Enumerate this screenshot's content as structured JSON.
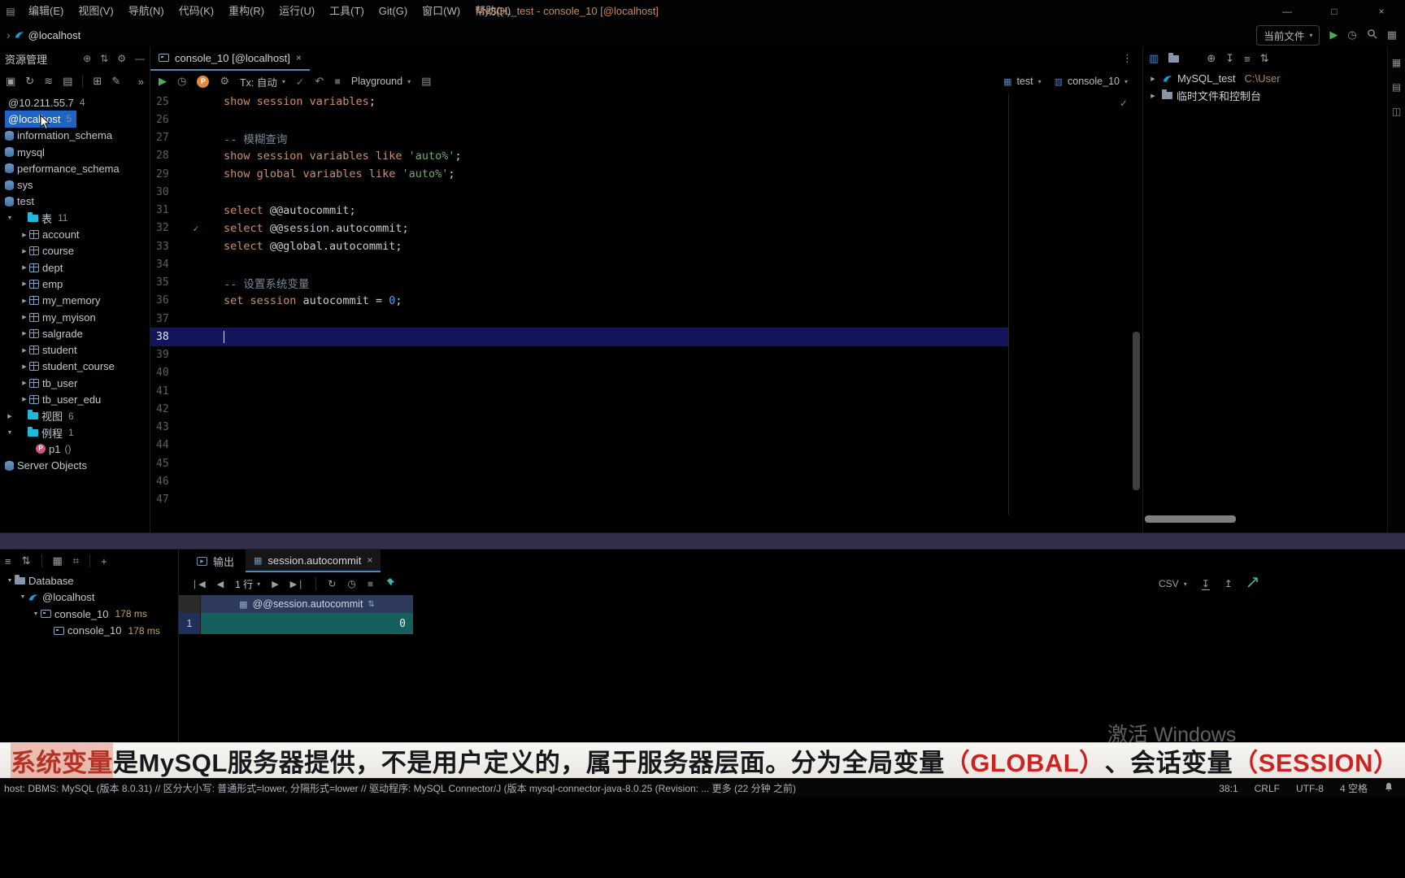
{
  "colors": {
    "accent_blue": "#1f63c4",
    "keyword_orange": "#cf8e6d",
    "string_green": "#6aab73",
    "number_blue": "#4fa0e8",
    "folder_cyan": "#1fb9da",
    "result_row_teal": "#15605c",
    "banner_red": "#cc2222"
  },
  "titlebar": {
    "menus": [
      "编辑(E)",
      "视图(V)",
      "导航(N)",
      "代码(K)",
      "重构(R)",
      "运行(U)",
      "工具(T)",
      "Git(G)",
      "窗口(W)",
      "帮助(H)"
    ],
    "title": "MySQL_test - console_10 [@localhost]",
    "window_controls": [
      "—",
      "□",
      "×"
    ]
  },
  "navbar": {
    "breadcrumb": "@localhost",
    "run_config": "当前文件"
  },
  "explorer": {
    "header": "资源管理",
    "tree": [
      {
        "label": "@10.211.55.7",
        "count": "4",
        "type": "host"
      },
      {
        "label": "@localhost",
        "count": "5",
        "type": "host",
        "sel": true
      },
      {
        "label": "information_schema",
        "type": "schema"
      },
      {
        "label": "mysql",
        "type": "schema"
      },
      {
        "label": "performance_schema",
        "type": "schema"
      },
      {
        "label": "sys",
        "type": "schema"
      },
      {
        "label": "test",
        "type": "schema"
      },
      {
        "label": "表",
        "count": "11",
        "type": "folder",
        "exp": true
      },
      {
        "label": "account",
        "type": "table"
      },
      {
        "label": "course",
        "type": "table"
      },
      {
        "label": "dept",
        "type": "table"
      },
      {
        "label": "emp",
        "type": "table"
      },
      {
        "label": "my_memory",
        "type": "table"
      },
      {
        "label": "my_myison",
        "type": "table"
      },
      {
        "label": "salgrade",
        "type": "table"
      },
      {
        "label": "student",
        "type": "table"
      },
      {
        "label": "student_course",
        "type": "table"
      },
      {
        "label": "tb_user",
        "type": "table"
      },
      {
        "label": "tb_user_edu",
        "type": "table"
      },
      {
        "label": "视图",
        "count": "6",
        "type": "folder",
        "exp": false
      },
      {
        "label": "例程",
        "count": "1",
        "type": "folder",
        "exp": true
      },
      {
        "label": "p1",
        "suffix": "()",
        "type": "proc"
      },
      {
        "label": "Server Objects",
        "type": "server"
      }
    ]
  },
  "editor": {
    "tab": "console_10 [@localhost]",
    "toolbar": {
      "tx_label": "Tx: 自动",
      "playground_label": "Playground",
      "db_selector": "test",
      "console_selector": "console_10"
    },
    "lines": [
      {
        "n": 25,
        "seg": [
          [
            "kw",
            "show session variables"
          ],
          [
            "pl",
            ";"
          ]
        ]
      },
      {
        "n": 26,
        "seg": []
      },
      {
        "n": 27,
        "seg": [
          [
            "cm",
            "-- 模糊查询"
          ]
        ]
      },
      {
        "n": 28,
        "seg": [
          [
            "kw",
            "show session variables like "
          ],
          [
            "str",
            "'auto%'"
          ],
          [
            "pl",
            ";"
          ]
        ]
      },
      {
        "n": 29,
        "seg": [
          [
            "kw",
            "show global variables like "
          ],
          [
            "str",
            "'auto%'"
          ],
          [
            "pl",
            ";"
          ]
        ]
      },
      {
        "n": 30,
        "seg": []
      },
      {
        "n": 31,
        "seg": [
          [
            "kw",
            "select "
          ],
          [
            "pl",
            "@@autocommit;"
          ]
        ]
      },
      {
        "n": 32,
        "mark": true,
        "seg": [
          [
            "kw",
            "select "
          ],
          [
            "pl",
            "@@session.autocommit;"
          ]
        ]
      },
      {
        "n": 33,
        "seg": [
          [
            "kw",
            "select "
          ],
          [
            "pl",
            "@@global.autocommit;"
          ]
        ]
      },
      {
        "n": 34,
        "seg": []
      },
      {
        "n": 35,
        "seg": [
          [
            "cm",
            "-- 设置系统变量"
          ]
        ]
      },
      {
        "n": 36,
        "seg": [
          [
            "kw",
            "set session "
          ],
          [
            "pl",
            "autocommit = "
          ],
          [
            "num",
            "0"
          ],
          [
            "pl",
            ";"
          ]
        ]
      },
      {
        "n": 37,
        "seg": []
      },
      {
        "n": 38,
        "cur": true,
        "seg": []
      },
      {
        "n": 39,
        "seg": []
      },
      {
        "n": 40,
        "seg": []
      },
      {
        "n": 41,
        "seg": []
      },
      {
        "n": 42,
        "seg": []
      },
      {
        "n": 43,
        "seg": []
      },
      {
        "n": 44,
        "seg": []
      },
      {
        "n": 45,
        "seg": []
      },
      {
        "n": 46,
        "seg": []
      },
      {
        "n": 47,
        "seg": []
      }
    ]
  },
  "right_panel": {
    "root": "MySQL_test",
    "root_path": "C:\\User",
    "child": "临时文件和控制台"
  },
  "services": {
    "tree": [
      {
        "label": "Database",
        "type": "dbfolder",
        "lvl": 0,
        "exp": true
      },
      {
        "label": "@localhost",
        "type": "mysql",
        "lvl": 1,
        "exp": true
      },
      {
        "label": "console_10",
        "time": "178 ms",
        "type": "console",
        "lvl": 2,
        "exp": true
      },
      {
        "label": "console_10",
        "time": "178 ms",
        "type": "console",
        "lvl": 3
      }
    ]
  },
  "results": {
    "output_tab_label": "输出",
    "result_tab_label": "session.autocommit",
    "pager_label": "1 行",
    "export_label": "CSV",
    "column_header": "@@session.autocommit",
    "rows": [
      {
        "num": "1",
        "value": "0"
      }
    ]
  },
  "subtitle": {
    "segments": [
      {
        "text": "系统变量",
        "style": "hl"
      },
      {
        "text": " 是MySQL服务器提供，不是用户定义的，属于服务器层面。分为全局变量",
        "style": "plain"
      },
      {
        "text": "（GLOBAL）",
        "style": "red"
      },
      {
        "text": "、会话变量",
        "style": "plain"
      },
      {
        "text": "（SESSION）",
        "style": "red"
      }
    ]
  },
  "watermark": "激活 Windows",
  "statusbar": {
    "left": "host: DBMS: MySQL (版本 8.0.31) // 区分大小写: 普通形式=lower, 分隔形式=lower // 驱动程序: MySQL Connector/J (版本 mysql-connector-java-8.0.25 (Revision: ... 更多 (22 分钟 之前)",
    "right": [
      "38:1",
      "CRLF",
      "UTF-8",
      "4 空格"
    ]
  }
}
